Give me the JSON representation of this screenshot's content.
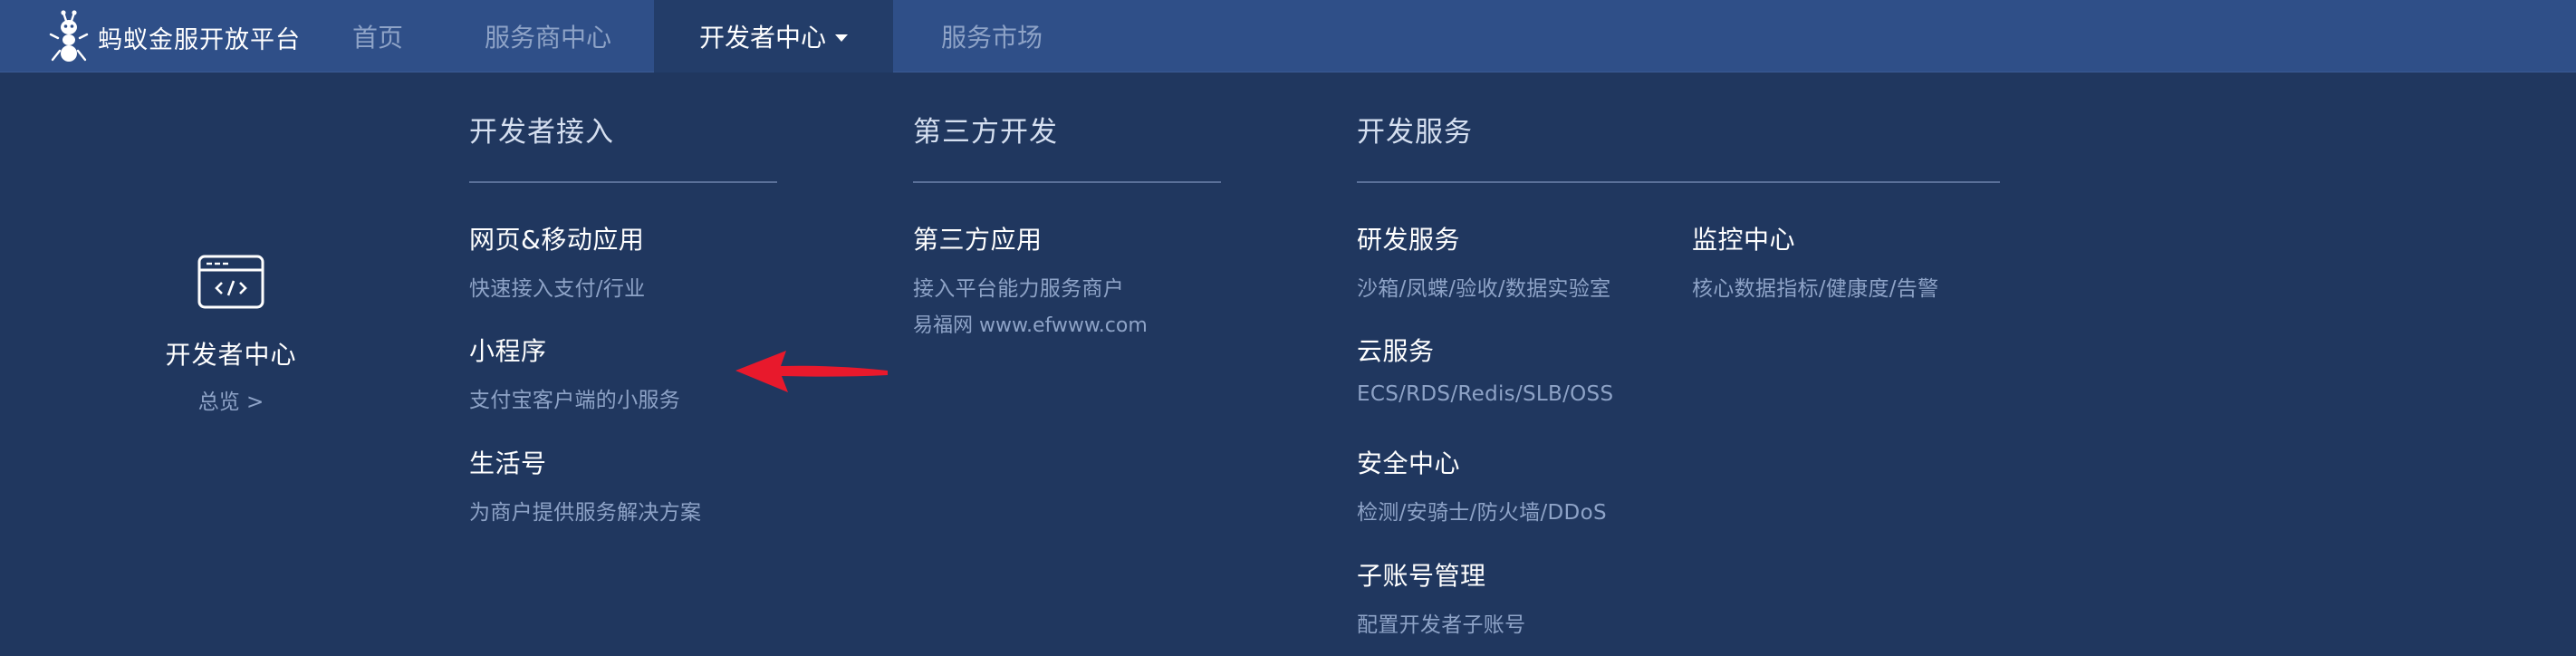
{
  "brand": {
    "name": "蚂蚁金服开放平台",
    "icon": "ant-logo-icon"
  },
  "nav": {
    "items": [
      {
        "label": "首页"
      },
      {
        "label": "服务商中心"
      },
      {
        "label": "开发者中心",
        "active": true
      },
      {
        "label": "服务市场"
      }
    ]
  },
  "overview": {
    "icon": "code-window-icon",
    "title": "开发者中心",
    "link": "总览 >"
  },
  "columns": [
    {
      "heading": "开发者接入",
      "items": [
        {
          "title": "网页&移动应用",
          "desc": "快速接入支付/行业"
        },
        {
          "title": "小程序",
          "desc": "支付宝客户端的小服务"
        },
        {
          "title": "生活号",
          "desc": "为商户提供服务解决方案"
        }
      ]
    },
    {
      "heading": "第三方开发",
      "items": [
        {
          "title": "第三方应用",
          "desc": "接入平台能力服务商户",
          "extra": "易福网  www.efwww.com"
        }
      ]
    },
    {
      "heading": "开发服务",
      "items": [
        {
          "title": "研发服务",
          "desc": "沙箱/凤蝶/验收/数据实验室"
        },
        {
          "title": "监控中心",
          "desc": "核心数据指标/健康度/告警"
        },
        {
          "title": "云服务",
          "desc": "ECS/RDS/Redis/SLB/OSS"
        },
        {
          "title": "安全中心",
          "desc": "检测/安骑士/防火墙/DDoS"
        },
        {
          "title": "子账号管理",
          "desc": "配置开发者子账号"
        }
      ]
    }
  ],
  "colors": {
    "background": "#20375f",
    "topbar": "#2f4f88",
    "active_tab": "#233d69",
    "muted_text": "#8ea3c7",
    "annotation_arrow": "#e8192c"
  }
}
